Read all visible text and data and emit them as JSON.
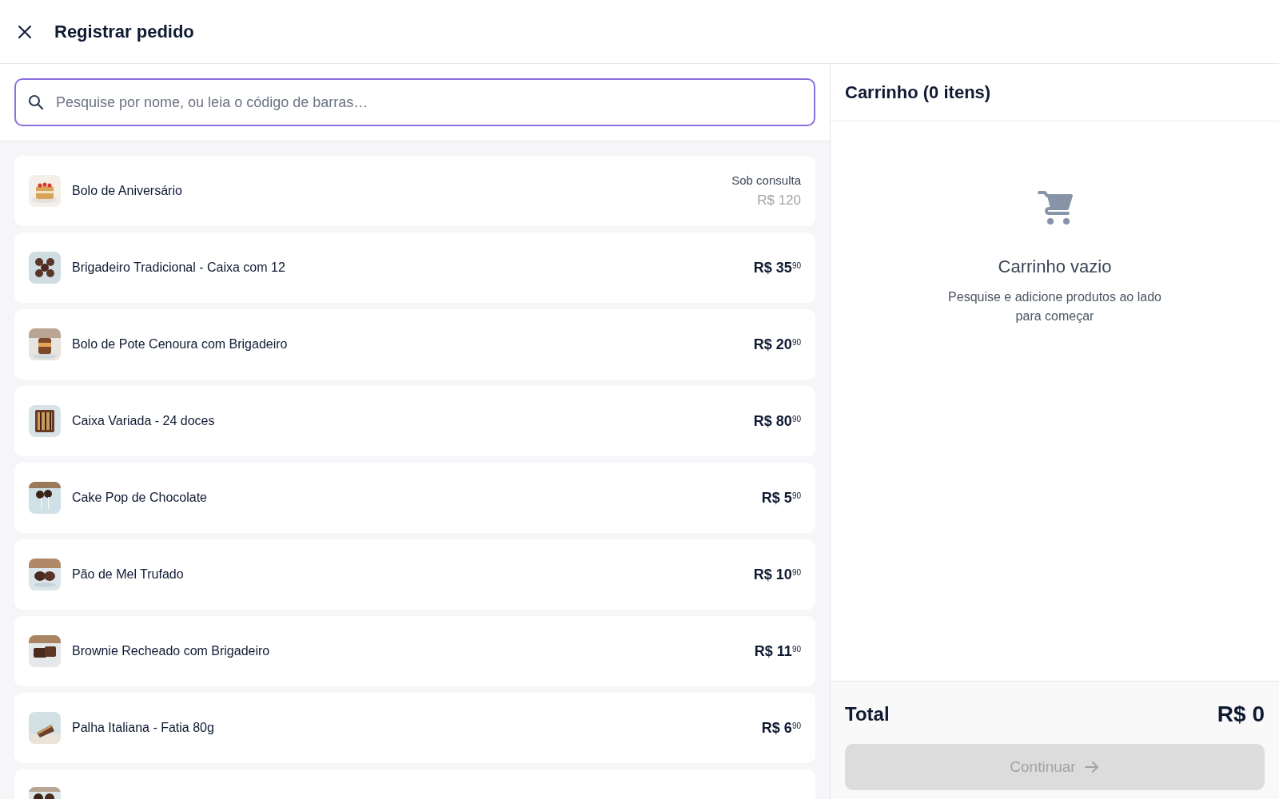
{
  "header": {
    "title": "Registrar pedido"
  },
  "search": {
    "placeholder": "Pesquise por nome, ou leia o código de barras…"
  },
  "products": [
    {
      "kind": "consult",
      "name": "Bolo de Aniversário",
      "note": "Sob consulta",
      "price": "R$ 120"
    },
    {
      "kind": "fixed",
      "name": "Brigadeiro Tradicional - Caixa com 12",
      "price": "R$ 35$^{90}$"
    },
    {
      "kind": "fixed",
      "name": "Bolo de Pote Cenoura com Brigadeiro",
      "price": "R$ 20$^{90}$"
    },
    {
      "kind": "fixed",
      "name": "Caixa Variada - 24 doces",
      "price": "R$ 80$^{90}$"
    },
    {
      "kind": "fixed",
      "name": "Cake Pop de Chocolate",
      "price": "R$ 5$^{90}$"
    },
    {
      "kind": "fixed",
      "name": "Pão de Mel Trufado",
      "price": "R$ 10$^{90}$"
    },
    {
      "kind": "fixed",
      "name": "Brownie Recheado com Brigadeiro",
      "price": "R$ 11$^{90}$"
    },
    {
      "kind": "fixed",
      "name": "Palha Italiana - Fatia 80g",
      "price": "R$ 6$^{90}$"
    },
    {
      "kind": "cut"
    }
  ],
  "cart": {
    "title": "Carrinho (0 itens)",
    "empty_title": "Carrinho vazio",
    "empty_text": "Pesquise e adicione produtos ao lado para começar",
    "total_label": "Total",
    "total": "R$ 0",
    "button": {
      "label": "Continuar",
      "disabled": true
    }
  }
}
